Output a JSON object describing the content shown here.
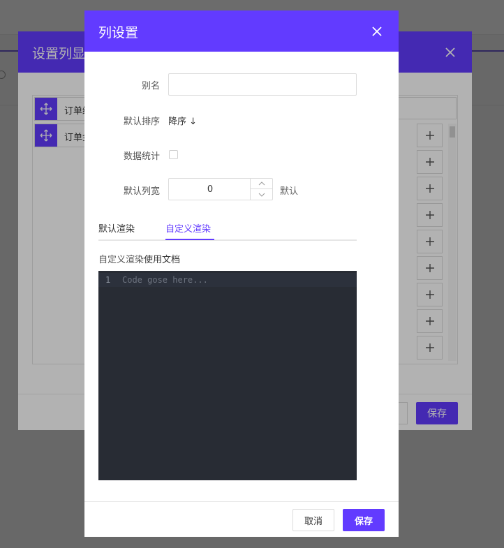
{
  "colors": {
    "accent": "#623bff",
    "editor_bg": "#282c34"
  },
  "background_modal": {
    "title": "设置列显",
    "fields": [
      {
        "label": "订单编",
        "icon": "move-icon"
      },
      {
        "label": "订单金",
        "icon": "move-icon"
      }
    ],
    "add_icon": "plus-icon",
    "add_button_count": 9,
    "save_label": "保存",
    "close_icon": "close-icon"
  },
  "dialog": {
    "title": "列设置",
    "close_icon": "close-icon",
    "alias": {
      "label": "别名",
      "value": "",
      "placeholder": ""
    },
    "default_sort": {
      "label": "默认排序",
      "value": "降序",
      "arrow": "↓"
    },
    "statistics": {
      "label": "数据统计",
      "checked": false
    },
    "default_width": {
      "label": "默认列宽",
      "value": "0",
      "suffix": "默认"
    },
    "tabs": [
      {
        "label": "默认渲染",
        "active": false
      },
      {
        "label": "自定义渲染",
        "active": true
      }
    ],
    "doc_link": {
      "prefix": "自定义渲染",
      "link": "使用文档"
    },
    "code_editor": {
      "line_number": "1",
      "placeholder": "Code gose here..."
    },
    "footer": {
      "cancel_label": "取消",
      "save_label": "保存"
    }
  }
}
